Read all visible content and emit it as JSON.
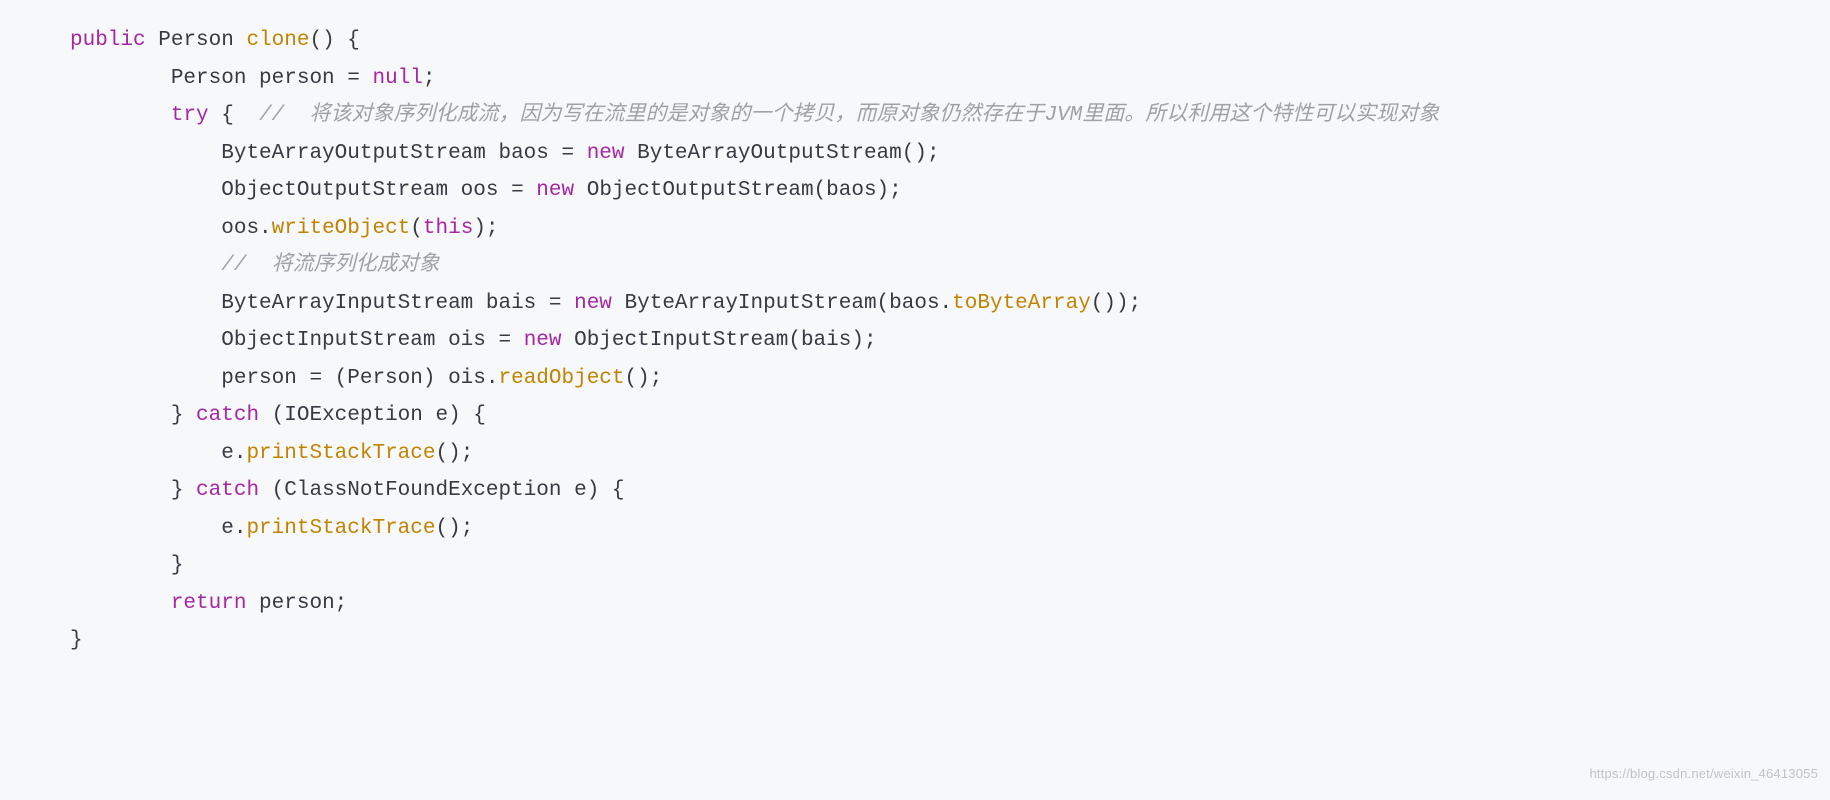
{
  "code": {
    "line1": {
      "kw1": "public",
      "type": "Person",
      "fn": "clone",
      "p1": "()",
      "p2": " {"
    },
    "ind1": "        ",
    "line2": {
      "t": "Person person = ",
      "kw": "null",
      "tail": ";"
    },
    "line3": {
      "kw": "try",
      "brace": " {  ",
      "cmt": "//  将该对象序列化成流，因为写在流里的是对象的一个拷贝，而原对象仍然存在于JVM里面。所以利用这个特性可以实现对象"
    },
    "ind2": "            ",
    "line4": {
      "a": "ByteArrayOutputStream baos = ",
      "kw": "new",
      "b": " ByteArrayOutputStream();"
    },
    "line5": {
      "a": "ObjectOutputStream oos = ",
      "kw": "new",
      "b": " ObjectOutputStream(baos);"
    },
    "line6": {
      "a": "oos.",
      "fn": "writeObject",
      "b": "(",
      "kw": "this",
      "c": ");"
    },
    "line7": {
      "cmt": "//  将流序列化成对象"
    },
    "line8": {
      "a": "ByteArrayInputStream bais = ",
      "kw": "new",
      "b": " ByteArrayInputStream(baos.",
      "fn": "toByteArray",
      "c": "());"
    },
    "line9": {
      "a": "ObjectInputStream ois = ",
      "kw": "new",
      "b": " ObjectInputStream(bais);"
    },
    "line10": {
      "a": "person = (Person) ois.",
      "fn": "readObject",
      "b": "();"
    },
    "line11": {
      "a": "} ",
      "kw": "catch",
      "b": " (IOException e) {"
    },
    "line12": {
      "a": "e.",
      "fn": "printStackTrace",
      "b": "();"
    },
    "line13": {
      "a": "} ",
      "kw": "catch",
      "b": " (ClassNotFoundException e) {"
    },
    "line14": {
      "a": "e.",
      "fn": "printStackTrace",
      "b": "();"
    },
    "line15": {
      "a": "}"
    },
    "line16": {
      "kw": "return",
      "a": " person;"
    },
    "line17": {
      "a": "}"
    }
  },
  "watermark": "https://blog.csdn.net/weixin_46413055"
}
